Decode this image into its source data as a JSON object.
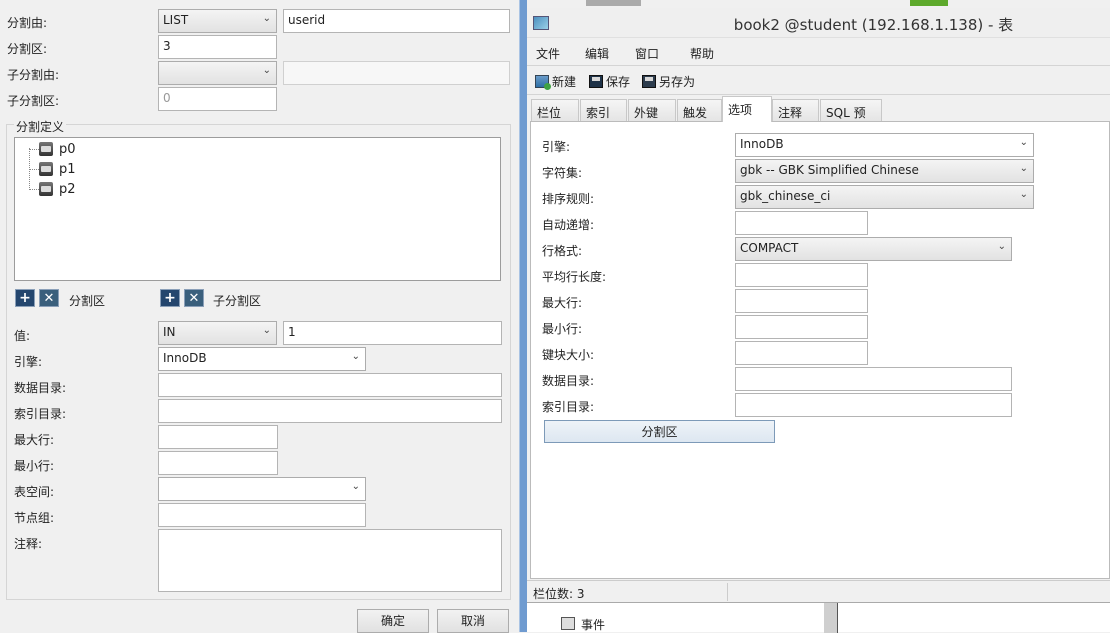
{
  "partition_dialog": {
    "partition_by_label": "分割由:",
    "partition_by_value": "LIST",
    "partition_by_expr": "userid",
    "partitions_label": "分割区:",
    "partitions_value": "3",
    "subpartition_by_label": "子分割由:",
    "subpartition_by_value": "",
    "subpartition_by_expr": "",
    "subpartitions_label": "子分割区:",
    "subpartitions_value": "0",
    "definition_legend": "分割定义",
    "partitions_tree": [
      {
        "name": "p0"
      },
      {
        "name": "p1"
      },
      {
        "name": "p2"
      }
    ],
    "partition_buttons_label": "分割区",
    "subpartition_buttons_label": "子分割区",
    "add_icon": "plus-icon",
    "delete_icon": "x-icon",
    "value_label": "值:",
    "value_op": "IN",
    "value_expr": "1",
    "engine_label": "引擎:",
    "engine_value": "InnoDB",
    "data_dir_label": "数据目录:",
    "data_dir_value": "",
    "index_dir_label": "索引目录:",
    "index_dir_value": "",
    "max_rows_label": "最大行:",
    "max_rows_value": "",
    "min_rows_label": "最小行:",
    "min_rows_value": "",
    "tablespace_label": "表空间:",
    "tablespace_value": "",
    "nodegroup_label": "节点组:",
    "nodegroup_value": "",
    "comment_label": "注释:",
    "comment_value": "",
    "ok_label": "确定",
    "cancel_label": "取消"
  },
  "table_window": {
    "title": "book2 @student (192.168.1.138) - 表",
    "menu": [
      "文件",
      "编辑",
      "窗口",
      "帮助"
    ],
    "toolbar": {
      "new_label": "新建",
      "save_label": "保存",
      "save_as_label": "另存为"
    },
    "tabs": [
      {
        "label": "栏位",
        "active": false
      },
      {
        "label": "索引",
        "active": false
      },
      {
        "label": "外键",
        "active": false
      },
      {
        "label": "触发器",
        "active": false
      },
      {
        "label": "选项",
        "active": true
      },
      {
        "label": "注释",
        "active": false
      },
      {
        "label": "SQL 预览",
        "active": false
      }
    ],
    "options": {
      "engine_label": "引擎:",
      "engine_value": "InnoDB",
      "charset_label": "字符集:",
      "charset_value": "gbk -- GBK Simplified Chinese",
      "collation_label": "排序规则:",
      "collation_value": "gbk_chinese_ci",
      "auto_inc_label": "自动递增:",
      "auto_inc_value": "",
      "row_format_label": "行格式:",
      "row_format_value": "COMPACT",
      "avg_row_len_label": "平均行长度:",
      "avg_row_len_value": "",
      "max_rows_label": "最大行:",
      "max_rows_value": "",
      "min_rows_label": "最小行:",
      "min_rows_value": "",
      "key_block_label": "键块大小:",
      "key_block_value": "",
      "data_dir_label": "数据目录:",
      "data_dir_value": "",
      "index_dir_label": "索引目录:",
      "index_dir_value": "",
      "partition_button": "分割区"
    },
    "status": "栏位数: 3",
    "background_tree_item": "事件"
  }
}
